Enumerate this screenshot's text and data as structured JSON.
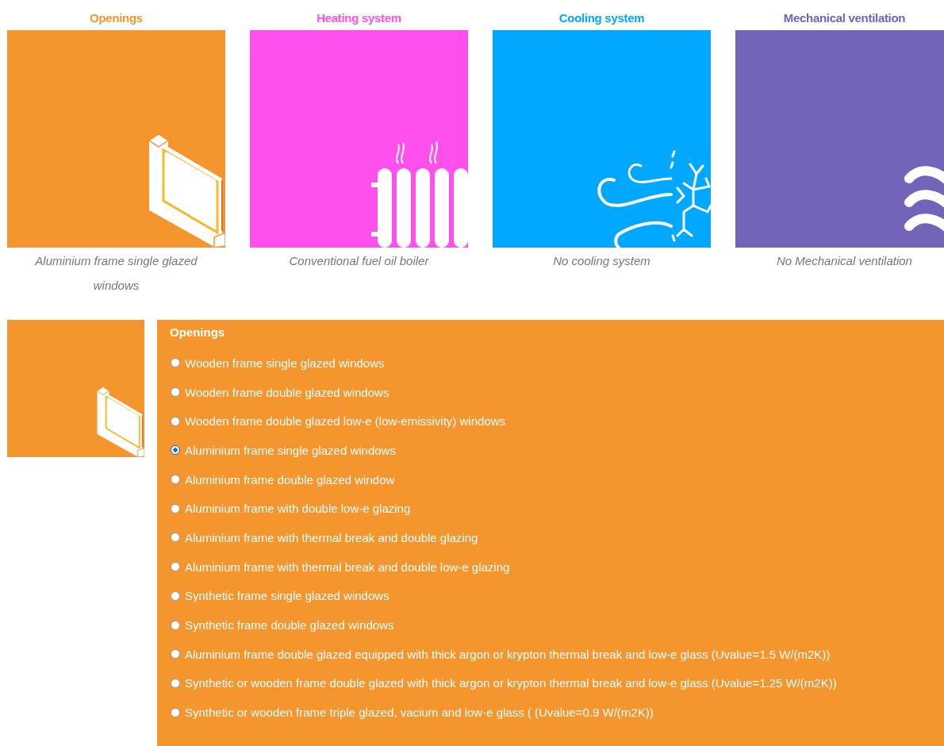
{
  "categories": [
    {
      "title": "Openings",
      "color": "#f4952d",
      "kind": "window",
      "caption": "Aluminium frame single glazed windows"
    },
    {
      "title": "Heating system",
      "color": "#ff50ee",
      "kind": "radiator",
      "caption": "Conventional fuel oil boiler"
    },
    {
      "title": "Cooling system",
      "color": "#00a8ff",
      "kind": "snowflake",
      "caption": "No cooling system"
    },
    {
      "title": "Mechanical ventilation",
      "color": "#7364b9",
      "kind": "waves",
      "caption": "No Mechanical ventilation"
    }
  ],
  "detail": {
    "title": "Openings",
    "color": "#f4952d",
    "kind": "window",
    "options": [
      {
        "label": "Wooden frame single glazed windows",
        "selected": false
      },
      {
        "label": "Wooden frame double glazed windows",
        "selected": false
      },
      {
        "label": "Wooden frame double glazed low-e (low-emissivity) windows",
        "selected": false
      },
      {
        "label": "Aluminium frame single glazed windows",
        "selected": true
      },
      {
        "label": "Aluminium frame double glazed window",
        "selected": false
      },
      {
        "label": "Aluminium frame with double low-e glazing",
        "selected": false
      },
      {
        "label": "Aluminium frame with thermal break and double glazing",
        "selected": false
      },
      {
        "label": "Aluminium frame with thermal break and double low-e glazing",
        "selected": false
      },
      {
        "label": "Synthetic frame single glazed windows",
        "selected": false
      },
      {
        "label": "Synthetic frame double glazed windows",
        "selected": false
      },
      {
        "label": "Aluminium frame double glazed equipped with thick argon or krypton thermal break and low-e glass (Uvalue=1.5 W/(m2K))",
        "selected": false
      },
      {
        "label": "Synthetic or wooden frame double glazed with thick argon or krypton thermal break and low-e glass (Uvalue=1.25 W/(m2K))",
        "selected": false
      },
      {
        "label": "Synthetic or wooden frame triple glazed, vacium and low-e glass ( (Uvalue=0.9 W/(m2K))",
        "selected": false
      }
    ]
  }
}
